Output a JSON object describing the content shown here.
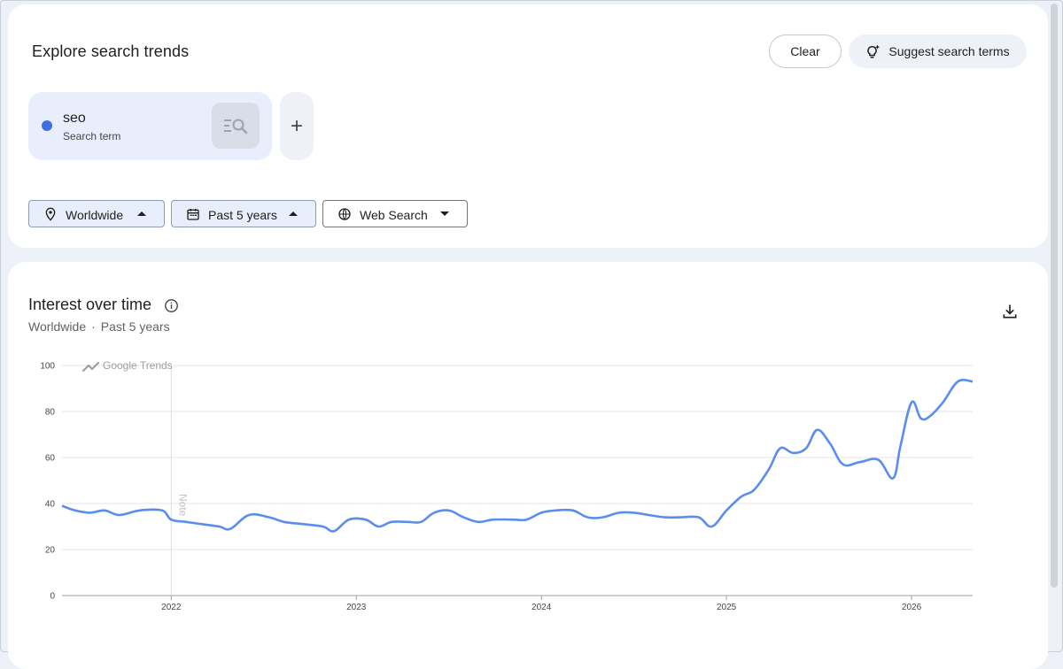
{
  "explore": {
    "title": "Explore search trends",
    "clear_label": "Clear",
    "suggest_label": "Suggest search terms",
    "term": {
      "name": "seo",
      "type": "Search term",
      "color": "#3d6fe0"
    },
    "add_label": "+",
    "filters": [
      {
        "label": "Worldwide",
        "icon": "location-pin-icon",
        "caret": "up"
      },
      {
        "label": "Past 5 years",
        "icon": "calendar-icon",
        "caret": "up"
      },
      {
        "label": "Web Search",
        "icon": "globe-icon",
        "caret": "down"
      }
    ]
  },
  "chart_card": {
    "title": "Interest over time",
    "subtitle_region": "Worldwide",
    "subtitle_separator": "·",
    "subtitle_period": "Past 5 years",
    "watermark": "Google Trends",
    "note_label": "Note"
  },
  "chart_data": {
    "type": "line",
    "title": "Interest over time",
    "xlabel": "",
    "ylabel": "",
    "ylim": [
      0,
      100
    ],
    "yticks": [
      0,
      20,
      40,
      60,
      80,
      100
    ],
    "xticks": [
      "2022",
      "2023",
      "2024",
      "2025",
      "2026"
    ],
    "x_range": [
      2021.41,
      2026.33
    ],
    "grid": true,
    "note_marker_x": 2022.0,
    "series": [
      {
        "color": "#5b8def",
        "x": [
          2021.41,
          2021.48,
          2021.56,
          2021.64,
          2021.72,
          2021.83,
          2021.95,
          2022.0,
          2022.08,
          2022.17,
          2022.26,
          2022.32,
          2022.42,
          2022.53,
          2022.61,
          2022.72,
          2022.82,
          2022.88,
          2022.96,
          2023.05,
          2023.12,
          2023.19,
          2023.28,
          2023.35,
          2023.42,
          2023.5,
          2023.58,
          2023.66,
          2023.74,
          2023.85,
          2023.92,
          2024.0,
          2024.08,
          2024.17,
          2024.25,
          2024.33,
          2024.42,
          2024.5,
          2024.58,
          2024.67,
          2024.75,
          2024.85,
          2024.92,
          2025.0,
          2025.08,
          2025.15,
          2025.23,
          2025.29,
          2025.36,
          2025.43,
          2025.49,
          2025.56,
          2025.63,
          2025.72,
          2025.82,
          2025.9,
          2025.94,
          2026.0,
          2026.05,
          2026.1,
          2026.17,
          2026.25,
          2026.33
        ],
        "values": [
          39,
          37,
          36,
          37,
          35,
          37,
          37,
          33,
          32,
          31,
          30,
          29,
          35,
          34,
          32,
          31,
          30,
          28,
          33,
          33,
          30,
          32,
          32,
          32,
          36,
          37,
          34,
          32,
          33,
          33,
          33,
          36,
          37,
          37,
          34,
          34,
          36,
          36,
          35,
          34,
          34,
          34,
          30,
          37,
          43,
          46,
          55,
          64,
          62,
          64,
          72,
          66,
          57,
          58,
          59,
          51,
          65,
          84,
          77,
          78,
          84,
          93,
          93
        ]
      }
    ]
  }
}
